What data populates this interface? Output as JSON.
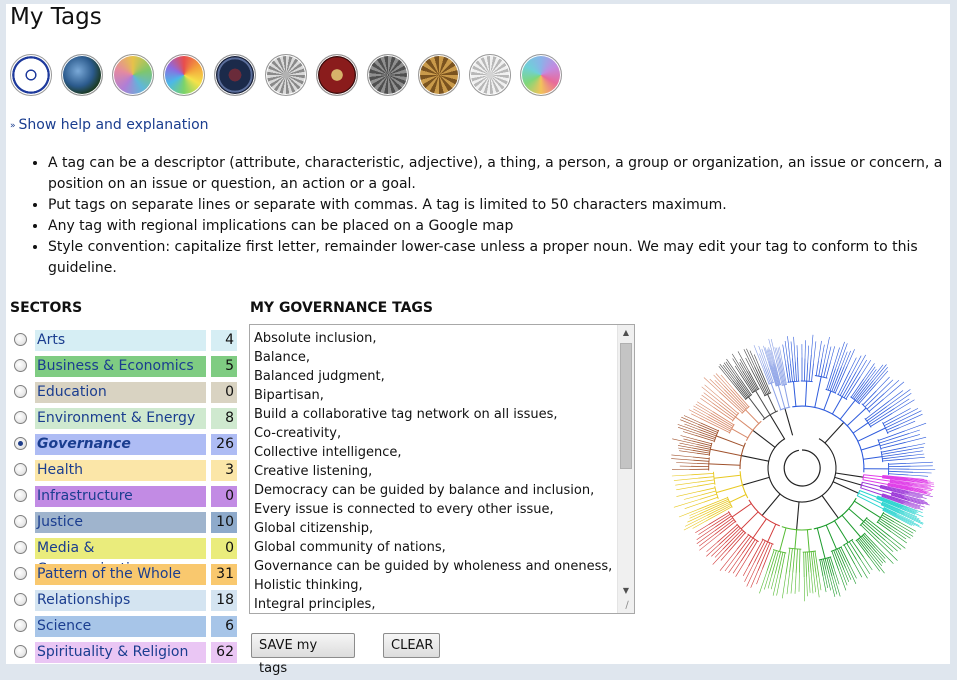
{
  "page": {
    "title": "My Tags"
  },
  "icons": [
    {
      "name": "dharma-wheel-icon",
      "label": "Governance"
    },
    {
      "name": "earth-globe-icon",
      "label": "Environment"
    },
    {
      "name": "color-mandala-icon",
      "label": "Mandala"
    },
    {
      "name": "rainbow-mandala-icon",
      "label": "Rainbow"
    },
    {
      "name": "dark-rose-window-icon",
      "label": "Rose window"
    },
    {
      "name": "gray-geometric-icon",
      "label": "Geometric"
    },
    {
      "name": "red-mandala-icon",
      "label": "Red mandala"
    },
    {
      "name": "gray-mandala-icon",
      "label": "Gray mandala"
    },
    {
      "name": "gold-mandala-icon",
      "label": "Gold mandala"
    },
    {
      "name": "white-mandala-icon",
      "label": "White mandala"
    },
    {
      "name": "sector-tree-icon",
      "label": "Tree"
    }
  ],
  "help": {
    "link_label": "Show help and explanation"
  },
  "bullets": [
    "A tag can be a descriptor (attribute, characteristic, adjective), a thing, a person, a group or organization, an issue or concern, a position on an issue or question, an action or a goal.",
    "Put tags on separate lines or separate with commas. A tag is limited to 50 characters maximum.",
    "Any tag with regional implications can be placed on a Google map",
    "Style convention: capitalize first letter, remainder lower-case unless a proper noun. We may edit your tag to conform to this guideline."
  ],
  "sectors_heading": "SECTORS",
  "tags_heading": "MY GOVERNANCE TAGS",
  "sectors": [
    {
      "label": "Arts",
      "count": "4",
      "bg": "#d6eef4",
      "count_bg": "#d6eef4",
      "checked": false
    },
    {
      "label": "Business & Economics",
      "count": "5",
      "bg": "#7fcc82",
      "count_bg": "#7fcc82",
      "checked": false
    },
    {
      "label": "Education",
      "count": "0",
      "bg": "#d9d3c2",
      "count_bg": "#d9d3c2",
      "checked": false
    },
    {
      "label": "Environment & Energy",
      "count": "8",
      "bg": "#cfe9cf",
      "count_bg": "#cfe9cf",
      "checked": false
    },
    {
      "label": "Governance",
      "count": "26",
      "bg": "#aebcf4",
      "count_bg": "#aebcf4",
      "checked": true
    },
    {
      "label": "Health",
      "count": "3",
      "bg": "#fbe6a8",
      "count_bg": "#fbe6a8",
      "checked": false
    },
    {
      "label": "Infrastructure",
      "count": "0",
      "bg": "#c28be4",
      "count_bg": "#c28be4",
      "checked": false
    },
    {
      "label": "Justice",
      "count": "10",
      "bg": "#9fb4cd",
      "count_bg": "#8eaacb",
      "checked": false
    },
    {
      "label": "Media & Communications",
      "count": "0",
      "bg": "#eaec7c",
      "count_bg": "#eaec7c",
      "checked": false
    },
    {
      "label": "Pattern of the Whole",
      "count": "31",
      "bg": "#f9c86e",
      "count_bg": "#f9c86e",
      "checked": false
    },
    {
      "label": "Relationships",
      "count": "18",
      "bg": "#d4e4f1",
      "count_bg": "#d4e4f1",
      "checked": false
    },
    {
      "label": "Science",
      "count": "6",
      "bg": "#a7c5e8",
      "count_bg": "#a7c5e8",
      "checked": false
    },
    {
      "label": "Spirituality & Religion",
      "count": "62",
      "bg": "#eac6f4",
      "count_bg": "#eac6f4",
      "checked": false
    }
  ],
  "tags_text": "Absolute inclusion,\nBalance,\nBalanced judgment,\nBipartisan,\nBuild a collaborative tag network on all issues,\nCo-creativity,\nCollective intelligence,\nCreative listening,\nDemocracy can be guided by balance and inclusion,\nEvery issue is connected to every other issue,\nGlobal citizenship,\nGlobal community of nations,\nGovernance can be guided by wholeness and oneness,\nHolistic thinking,\nIntegral principles,",
  "buttons": {
    "save": "SAVE my tags",
    "clear": "CLEAR"
  },
  "tree_colors": [
    "#2e5bdc",
    "#9b36d8",
    "#e040e8",
    "#2ad4d0",
    "#1a9a2a",
    "#55bb33",
    "#d23a3a",
    "#e8c820",
    "#a0522d",
    "#d88a6a",
    "#4a4a4a",
    "#8aa0e6"
  ]
}
